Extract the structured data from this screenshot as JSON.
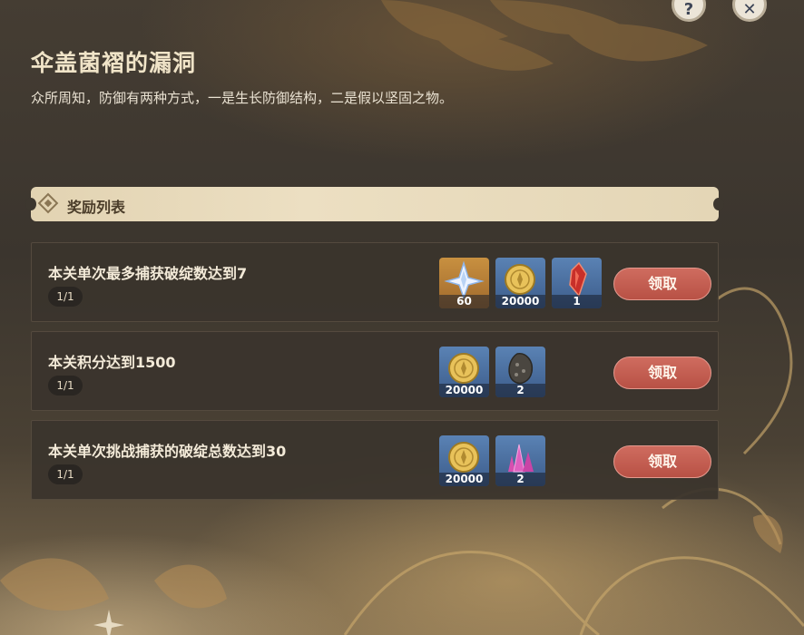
{
  "event": {
    "title": "伞盖菌褶的漏洞",
    "description": "众所周知，防御有两种方式，一是生长防御结构，二是假以坚固之物。"
  },
  "top_buttons": [
    {
      "name": "help-icon",
      "glyph": "?"
    },
    {
      "name": "close-icon",
      "glyph": "✕"
    }
  ],
  "rewards_header": {
    "label": "奖励列表"
  },
  "colors": {
    "claim_button": "#c45e52",
    "header_bar": "#e8dbbd",
    "row_bg": "#3a342d",
    "title": "#f0e4c8"
  },
  "tasks": [
    {
      "description": "本关单次最多捕获破绽数达到7",
      "progress": "1/1",
      "rewards": [
        {
          "icon": "primogem-icon",
          "qty": "60",
          "rarity": "gold"
        },
        {
          "icon": "mora-icon",
          "qty": "20000",
          "rarity": "blue"
        },
        {
          "icon": "red-crystal-icon",
          "qty": "1",
          "rarity": "blue"
        }
      ],
      "button": "领取"
    },
    {
      "description": "本关积分达到1500",
      "progress": "1/1",
      "rewards": [
        {
          "icon": "mora-icon",
          "qty": "20000",
          "rarity": "blue"
        },
        {
          "icon": "ore-icon",
          "qty": "2",
          "rarity": "blue"
        }
      ],
      "button": "领取"
    },
    {
      "description": "本关单次挑战捕获的破绽总数达到30",
      "progress": "1/1",
      "rewards": [
        {
          "icon": "mora-icon",
          "qty": "20000",
          "rarity": "blue"
        },
        {
          "icon": "purple-crystal-icon",
          "qty": "2",
          "rarity": "blue"
        }
      ],
      "button": "领取"
    }
  ]
}
